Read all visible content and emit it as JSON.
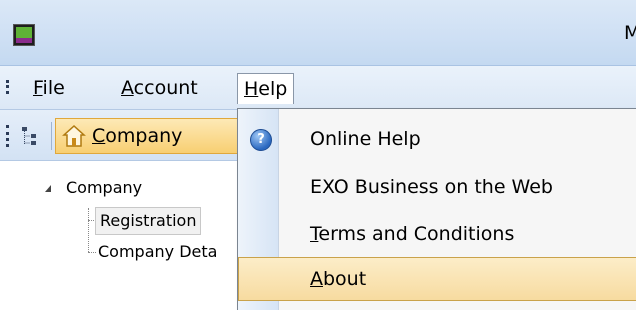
{
  "window": {
    "title": "M"
  },
  "menubar": {
    "items": [
      {
        "label": "File",
        "u": "F",
        "rest": "ile"
      },
      {
        "label": "Account",
        "u": "A",
        "rest": "ccount"
      },
      {
        "label": "Help",
        "u": "H",
        "rest": "elp"
      }
    ]
  },
  "toolbar": {
    "company_button": {
      "u": "C",
      "rest": "ompany"
    }
  },
  "tree": {
    "root": "Company",
    "children": [
      "Registration",
      "Company Deta"
    ]
  },
  "help_menu": {
    "items": [
      {
        "label": "Online Help"
      },
      {
        "label": "EXO Business on the Web"
      },
      {
        "u": "T",
        "rest": "erms and Conditions"
      },
      {
        "u": "A",
        "rest": "bout"
      }
    ]
  },
  "icons": {
    "app": "app-icon",
    "tree_view": "tree-view-icon",
    "home": "home-icon",
    "help": "help-icon"
  },
  "colors": {
    "hover_fill": "#f7dba0",
    "toolbar_button": "#f8cf72",
    "menubar_bg": "#dce8f6"
  }
}
